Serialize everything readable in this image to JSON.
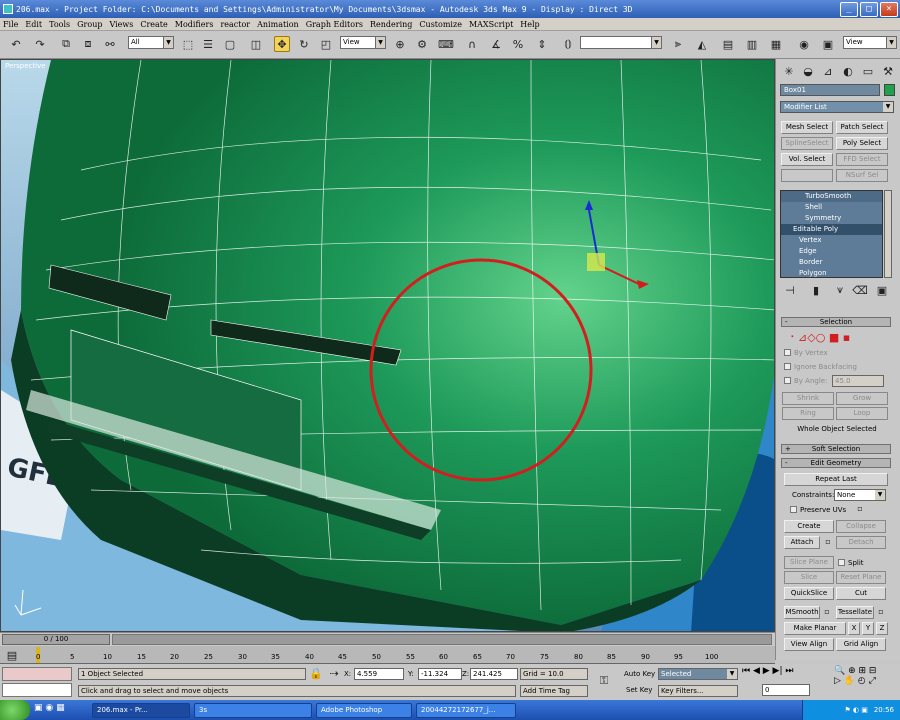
{
  "window": {
    "title": "206.max    - Project Folder: C:\\Documents and Settings\\Administrator\\My Documents\\3dsmax    - Autodesk 3ds Max 9       - Display : Direct 3D",
    "minimize": "_",
    "maximize": "□",
    "close": "×"
  },
  "menu": [
    "File",
    "Edit",
    "Tools",
    "Group",
    "Views",
    "Create",
    "Modifiers",
    "reactor",
    "Animation",
    "Graph Editors",
    "Rendering",
    "Customize",
    "MAXScript",
    "Help"
  ],
  "toolbar": {
    "selection_filter": "All",
    "ref_coord": "View",
    "named_selection": "",
    "render_type": "View"
  },
  "viewport": {
    "label": "Perspective",
    "mesh_color": "#1e9a5a",
    "highlight_color": "#d21e1e"
  },
  "command_panel": {
    "object_name": "Box01",
    "object_color": "#1fa04a",
    "modifier_list": "Modifier List",
    "modifier_buttons": [
      {
        "label": "Mesh Select",
        "enabled": true
      },
      {
        "label": "Patch Select",
        "enabled": true
      },
      {
        "label": "SplineSelect",
        "enabled": false
      },
      {
        "label": "Poly Select",
        "enabled": true
      },
      {
        "label": "Vol. Select",
        "enabled": true
      },
      {
        "label": "FFD Select",
        "enabled": false
      },
      {
        "label": "",
        "enabled": false
      },
      {
        "label": "NSurf Sel",
        "enabled": false
      }
    ],
    "stack": [
      "TurboSmooth",
      "Shell",
      "Symmetry",
      "Editable Poly",
      "Vertex",
      "Edge",
      "Border",
      "Polygon"
    ],
    "selection_rollout": "Selection",
    "by_vertex": "By Vertex",
    "ignore_backfacing": "Ignore Backfacing",
    "by_angle": "By Angle:",
    "angle_value": "45.0",
    "shrink": "Shrink",
    "grow": "Grow",
    "ring": "Ring",
    "loop": "Loop",
    "selection_status": "Whole Object Selected",
    "soft_selection": "Soft Selection",
    "edit_geometry": "Edit Geometry",
    "repeat_last": "Repeat Last",
    "constraints_label": "Constraints:",
    "constraints_value": "None",
    "preserve_uvs": "Preserve UVs",
    "create": "Create",
    "collapse": "Collapse",
    "attach": "Attach",
    "detach": "Detach",
    "slice_plane": "Slice Plane",
    "split": "Split",
    "slice": "Slice",
    "reset_plane": "Reset Plane",
    "quickslice": "QuickSlice",
    "cut": "Cut",
    "msmooth": "MSmooth",
    "tessellate": "Tessellate",
    "make_planar": "Make Planar",
    "x": "X",
    "y": "Y",
    "z": "Z",
    "view_align": "View Align",
    "grid_align": "Grid Align"
  },
  "timeline": {
    "slider": "0 / 100",
    "ticks": [
      "0",
      "5",
      "10",
      "15",
      "20",
      "25",
      "30",
      "35",
      "40",
      "45",
      "50",
      "55",
      "60",
      "65",
      "70",
      "75",
      "80",
      "85",
      "90",
      "95",
      "100"
    ]
  },
  "status": {
    "selection": "1 Object Selected",
    "prompt": "Click and drag to select and move objects",
    "x_label": "X:",
    "x_value": "4.559",
    "y_label": "Y:",
    "y_value": "-11.324",
    "z_label": "Z:",
    "z_value": "241.425",
    "grid": "Grid = 10.0",
    "add_time_tag": "Add Time Tag",
    "auto_key": "Auto Key",
    "set_key": "Set Key",
    "key_mode": "Selected",
    "key_filters": "Key Filters...",
    "frame": "0"
  },
  "taskbar": {
    "tasks": [
      "206.max    - Pr...",
      "3s",
      "Adobe Photoshop",
      "20044272172677_j..."
    ],
    "clock": "20:56"
  }
}
